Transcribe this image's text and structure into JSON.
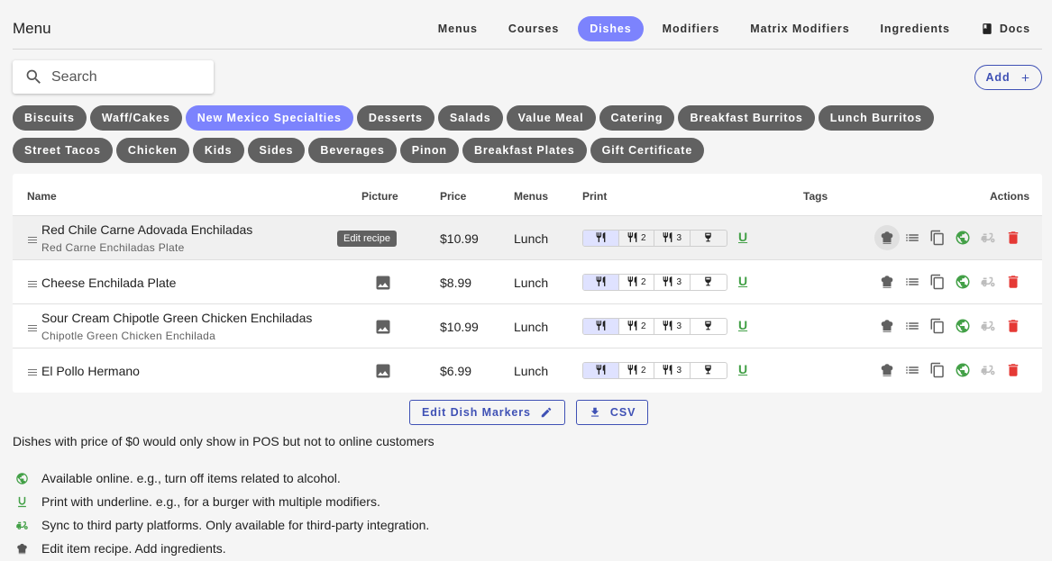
{
  "header": {
    "title": "Menu",
    "nav": [
      {
        "label": "Menus",
        "active": false
      },
      {
        "label": "Courses",
        "active": false
      },
      {
        "label": "Dishes",
        "active": true
      },
      {
        "label": "Modifiers",
        "active": false
      },
      {
        "label": "Matrix Modifiers",
        "active": false
      },
      {
        "label": "Ingredients",
        "active": false
      }
    ],
    "docs_label": "Docs"
  },
  "search": {
    "placeholder": "Search"
  },
  "add_label": "Add",
  "categories": [
    {
      "label": "Biscuits",
      "active": false
    },
    {
      "label": "Waff/Cakes",
      "active": false
    },
    {
      "label": "New Mexico Specialties",
      "active": true
    },
    {
      "label": "Desserts",
      "active": false
    },
    {
      "label": "Salads",
      "active": false
    },
    {
      "label": "Value Meal",
      "active": false
    },
    {
      "label": "Catering",
      "active": false
    },
    {
      "label": "Breakfast Burritos",
      "active": false
    },
    {
      "label": "Lunch Burritos",
      "active": false
    },
    {
      "label": "Street Tacos",
      "active": false
    },
    {
      "label": "Chicken",
      "active": false
    },
    {
      "label": "Kids",
      "active": false
    },
    {
      "label": "Sides",
      "active": false
    },
    {
      "label": "Beverages",
      "active": false
    },
    {
      "label": "Pinon",
      "active": false
    },
    {
      "label": "Breakfast Plates",
      "active": false
    },
    {
      "label": "Gift Certificate",
      "active": false
    }
  ],
  "table": {
    "headers": {
      "name": "Name",
      "picture": "Picture",
      "price": "Price",
      "menus": "Menus",
      "print": "Print",
      "tags": "Tags",
      "actions": "Actions"
    },
    "rows": [
      {
        "name": "Red Chile Carne Adovada Enchiladas",
        "sub": "Red Carne Enchiladas Plate",
        "price": "$10.99",
        "menus": "Lunch"
      },
      {
        "name": "Cheese Enchilada Plate",
        "sub": "",
        "price": "$8.99",
        "menus": "Lunch"
      },
      {
        "name": "Sour Cream Chipotle Green Chicken Enchiladas",
        "sub": "Chipotle Green Chicken Enchilada",
        "price": "$10.99",
        "menus": "Lunch"
      },
      {
        "name": "El Pollo Hermano",
        "sub": "",
        "price": "$6.99",
        "menus": "Lunch"
      }
    ],
    "print_labels": [
      "",
      "2",
      "3",
      ""
    ],
    "underline_mark": "U"
  },
  "tooltip": "Edit recipe",
  "buttons": {
    "edit_markers": "Edit Dish Markers",
    "csv": "CSV"
  },
  "note": "Dishes with price of $0 would only show in POS but not to online customers",
  "legend": [
    {
      "icon": "globe-icon",
      "text": "Available online. e.g., turn off items related to alcohol."
    },
    {
      "icon": "underline-icon",
      "text": "Print with underline. e.g., for a burger with multiple modifiers."
    },
    {
      "icon": "sync-scooter-icon",
      "text": "Sync to third party platforms. Only available for third-party integration."
    },
    {
      "icon": "chef-hat-icon",
      "text": "Edit item recipe. Add ingredients."
    }
  ],
  "colors": {
    "accent": "#7c83fd",
    "chip": "#616161",
    "primary": "#3f51b5",
    "green": "#43a047",
    "red": "#e53935"
  }
}
